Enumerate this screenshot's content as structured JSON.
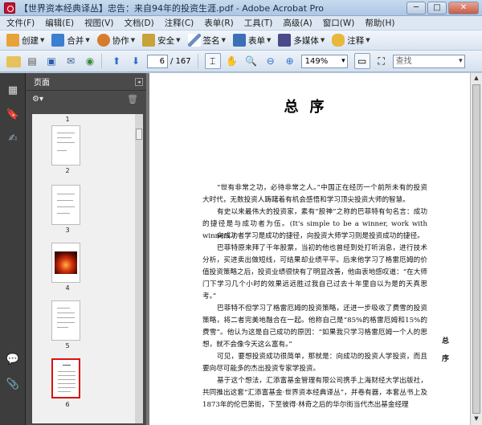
{
  "window": {
    "title": "【世界资本经典译丛】忠告：来自94年的投资生涯.pdf - Adobe Acrobat Pro",
    "minimize": "─",
    "maximize": "□",
    "close": "✕"
  },
  "menu": [
    "文件(F)",
    "编辑(E)",
    "视图(V)",
    "文档(D)",
    "注释(C)",
    "表单(R)",
    "工具(T)",
    "高级(A)",
    "窗口(W)",
    "帮助(H)"
  ],
  "tasks": [
    {
      "label": "创建",
      "icon": "create-icon",
      "color": "#e8a23a"
    },
    {
      "label": "合并",
      "icon": "combine-icon",
      "color": "#3b7fd1"
    },
    {
      "label": "协作",
      "icon": "collaborate-icon",
      "color": "#d77b2c"
    },
    {
      "label": "安全",
      "icon": "lock-icon",
      "color": "#c9a33a"
    },
    {
      "label": "签名",
      "icon": "pen-icon",
      "color": "#6a8fc0"
    },
    {
      "label": "表单",
      "icon": "form-icon",
      "color": "#3b6fb8"
    },
    {
      "label": "多媒体",
      "icon": "multimedia-icon",
      "color": "#4a4a8a"
    },
    {
      "label": "注释",
      "icon": "comment-icon",
      "color": "#e8b83a"
    }
  ],
  "nav": {
    "page_current": "6",
    "page_total": "/ 167",
    "zoom": "149%",
    "search_placeholder": "查找"
  },
  "panel": {
    "title": "页面",
    "thumb_labels": [
      "1",
      "2",
      "3",
      "4",
      "5",
      "6"
    ]
  },
  "document": {
    "heading": "总序",
    "paragraphs": [
      "“世有非常之功，必待非常之人。”中国正在经历一个前所未有的投资大时代，无数投资人踌躇着有机会感悟和学习顶尖投资大师的智慧。",
      "有史以来最伟大的投资家，素有“股神”之称的巴菲特有句名言：成功的捷径是与成功者为伍。(It's simple to be a winner, work with winners.)",
      "向成功者学习是成功的捷径，向投资大师学习则是投资成功的捷径。",
      "巴菲特原来拜了千年股票，当初的他也曾经到处打听消息，进行技术分析，买进卖出做短线，可结果却业绩平平。后来他学习了格雷厄姆的价值投资策略之后，投资业绩很快有了明显改善，他由衷地感叹道：“在大师门下学习几个小时的效果远远胜过我自己过去十年里自以为是的天真思考。”",
      "巴菲特不但学习了格雷厄姆的投资策略，还进一步吸收了费雪的投资策略，将二者完美地融合在一起。他称自己是“85%的格雷厄姆和15%的费雪”。他认为这是自己成功的原因：“如果我只学习格雷厄姆一个人的思想，就不会像今天这么富有。”",
      "可见，要想投资成功很简单，那就是：向成功的投资人学投资，而且要向尽可能多的杰出投资专家学投资。",
      "基于这个想法，汇添富基金管理有限公司携手上海财经大学出版社，共同推出这套“汇添富基金·世界资本经典译丛”，并卷有器，本套丛书上及1873年的伦巴第街，下至彼得·林奇之后的华尔街当代杰出基金经理"
    ],
    "side_marks": [
      "总",
      "序"
    ]
  }
}
